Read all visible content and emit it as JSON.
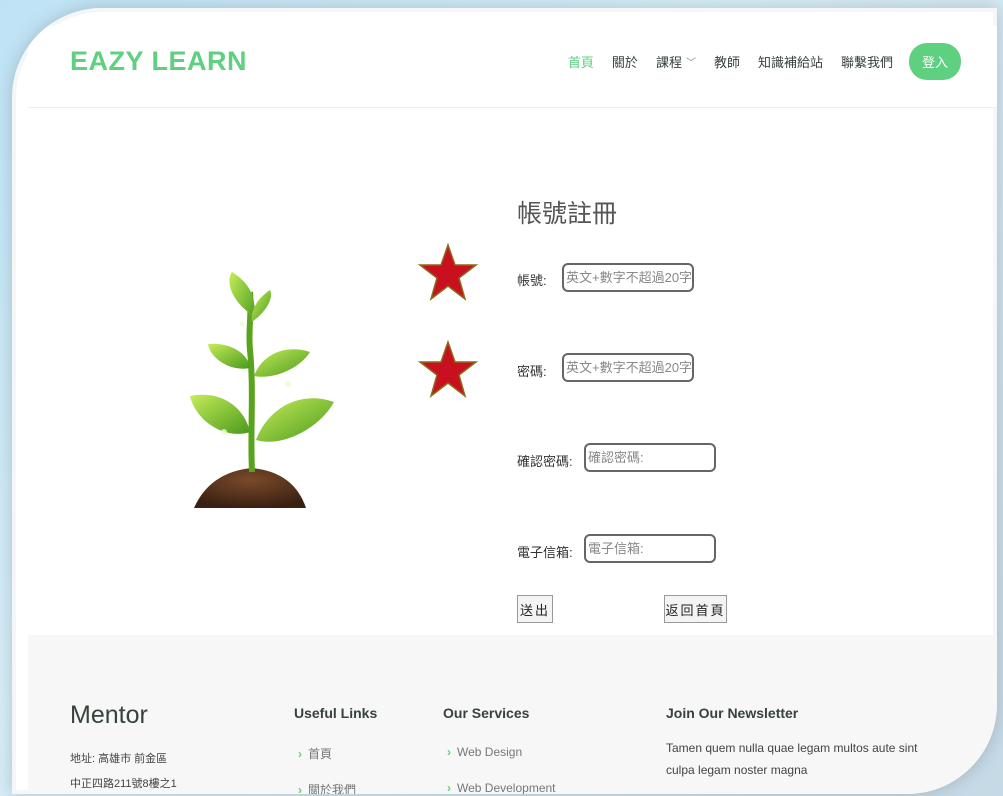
{
  "header": {
    "logo": "EAZY LEARN",
    "nav": [
      {
        "label": "首頁",
        "active": true
      },
      {
        "label": "關於",
        "active": false
      },
      {
        "label": "課程",
        "active": false,
        "dropdown": true
      },
      {
        "label": "教師",
        "active": false
      },
      {
        "label": "知識補給站",
        "active": false
      },
      {
        "label": "聯繫我們",
        "active": false
      }
    ],
    "login_label": "登入"
  },
  "form": {
    "title": "帳號註冊",
    "account_label": "帳號:",
    "account_placeholder": "英文+數字不超過20字",
    "password_label": "密碼:",
    "password_placeholder": "英文+數字不超過20字",
    "confirm_label": "確認密碼:",
    "confirm_placeholder": "確認密碼:",
    "email_label": "電子信箱:",
    "email_placeholder": "電子信箱:",
    "submit_label": "送出",
    "back_label": "返回首頁"
  },
  "footer": {
    "brand": "Mentor",
    "address_line1": "地址: 高雄市 前金區",
    "address_line2": "中正四路211號8樓之1",
    "useful_links_title": "Useful Links",
    "useful_links": [
      "首頁",
      "關於我們"
    ],
    "services_title": "Our Services",
    "services": [
      "Web Design",
      "Web Development"
    ],
    "newsletter_title": "Join Our Newsletter",
    "newsletter_text": "Tamen quem nulla quae legam multos aute sint culpa legam noster magna"
  },
  "colors": {
    "accent": "#5fcf80",
    "star": "#c8101e"
  }
}
